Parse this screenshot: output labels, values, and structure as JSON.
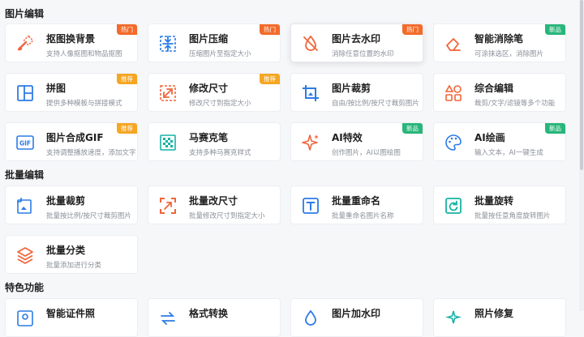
{
  "sections": {
    "image_edit": "图片编辑",
    "batch_edit": "批量编辑",
    "featured": "特色功能"
  },
  "cards": {
    "c1": {
      "title": "抠图换背景",
      "desc": "支持人像抠图和物品抠图",
      "badge": "热门"
    },
    "c2": {
      "title": "图片压缩",
      "desc": "压缩图片至指定大小",
      "badge": "热门"
    },
    "c3": {
      "title": "图片去水印",
      "desc": "消除任意位置的水印",
      "badge": "热门"
    },
    "c4": {
      "title": "智能消除笔",
      "desc": "可涂抹选区，消除图片",
      "badge": "新品"
    },
    "c5": {
      "title": "拼图",
      "desc": "提供多种模板与拼接模式",
      "badge": "推荐"
    },
    "c6": {
      "title": "修改尺寸",
      "desc": "修改尺寸到指定大小",
      "badge": "推荐"
    },
    "c7": {
      "title": "图片裁剪",
      "desc": "自由/按比例/按尺寸裁剪图片",
      "badge": ""
    },
    "c8": {
      "title": "综合编辑",
      "desc": "裁剪/文字/滤镜等多个功能",
      "badge": ""
    },
    "c9": {
      "title": "图片合成GIF",
      "desc": "支持调整播放速度，添加文字",
      "badge": "推荐"
    },
    "c10": {
      "title": "马赛克笔",
      "desc": "支持多种马赛克样式",
      "badge": ""
    },
    "c11": {
      "title": "AI特效",
      "desc": "创作图片，AI以图绘图",
      "badge": "新品"
    },
    "c12": {
      "title": "AI绘画",
      "desc": "输入文本，AI一键生成",
      "badge": "新品"
    },
    "b1": {
      "title": "批量裁剪",
      "desc": "批量按比例/按尺寸裁剪图片"
    },
    "b2": {
      "title": "批量改尺寸",
      "desc": "批量修改尺寸到指定大小"
    },
    "b3": {
      "title": "批量重命名",
      "desc": "批量重命名图片名称"
    },
    "b4": {
      "title": "批量旋转",
      "desc": "批量按任意角度旋转图片"
    },
    "b5": {
      "title": "批量分类",
      "desc": "批量添加进行分类"
    },
    "f1": {
      "title": "智能证件照"
    },
    "f2": {
      "title": "格式转换"
    },
    "f3": {
      "title": "图片加水印"
    },
    "f4": {
      "title": "照片修复"
    }
  },
  "colors": {
    "hot": "#f26b2a",
    "recommend": "#f5a623",
    "new": "#28b67a",
    "orange_icon": "#f0653a",
    "blue_icon": "#2c7be5",
    "teal_icon": "#17b3a3"
  },
  "icons": {
    "c1": "cutout-icon",
    "c2": "compress-icon",
    "c3": "no-watermark-icon",
    "c4": "eraser-icon",
    "c5": "collage-icon",
    "c6": "resize-icon",
    "c7": "crop-icon",
    "c8": "multi-edit-icon",
    "c9": "gif-icon",
    "c10": "mosaic-icon",
    "c11": "sparkle-icon",
    "c12": "palette-icon"
  }
}
